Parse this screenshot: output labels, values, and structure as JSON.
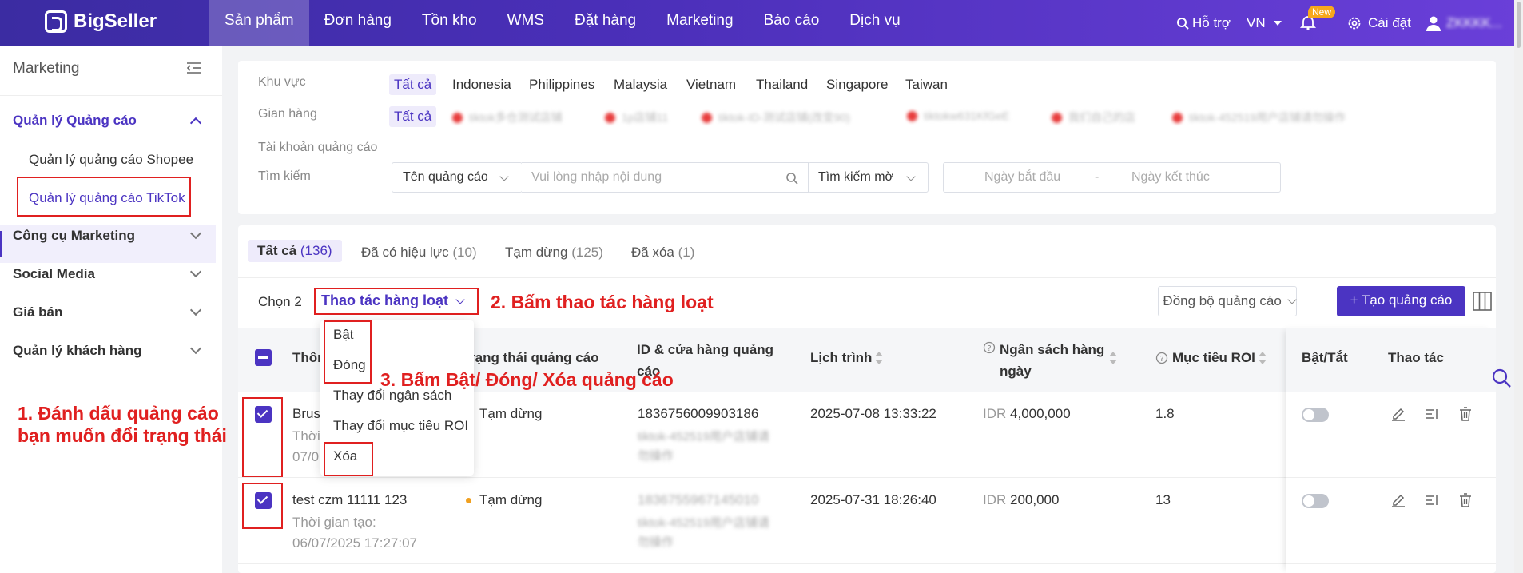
{
  "app": {
    "logo_text": "BigSeller"
  },
  "topnav": {
    "items": [
      "Sản phẩm",
      "Đơn hàng",
      "Tồn kho",
      "WMS",
      "Đặt hàng",
      "Marketing",
      "Báo cáo",
      "Dịch vụ"
    ],
    "support": "Hỗ trợ",
    "lang": "VN",
    "new_badge": "New",
    "settings": "Cài đặt",
    "user": "ZKKKK..."
  },
  "sidebar": {
    "title": "Marketing",
    "group_open": "Quản lý Quảng cáo",
    "sub_items": [
      "Quản lý quảng cáo Shopee",
      "Quản lý quảng cáo TikTok"
    ],
    "groups": [
      "Công cụ Marketing",
      "Social Media",
      "Giá bán",
      "Quản lý khách hàng"
    ]
  },
  "filters": {
    "region_label": "Khu vực",
    "regions": [
      "Tất cả",
      "Indonesia",
      "Philippines",
      "Malaysia",
      "Vietnam",
      "Thailand",
      "Singapore",
      "Taiwan"
    ],
    "store_label": "Gian hàng",
    "store_all": "Tất cả",
    "stores": [
      "tiktok多仓测试店铺",
      "1p店铺11",
      "tiktok-ID-测试店铺(改变90)",
      "tiktokw631KfGeE",
      "我们自己的店",
      "tiktok-452519用户店铺请勿操作"
    ],
    "account_label": "Tài khoản quảng cáo",
    "search_label": "Tìm kiếm",
    "search_field": "Tên quảng cáo",
    "search_placeholder": "Vui lòng nhập nội dung",
    "search_mode": "Tìm kiếm mờ",
    "date_start": "Ngày bắt đầu",
    "date_sep": "-",
    "date_end": "Ngày kết thúc"
  },
  "tabs": [
    {
      "label": "Tất cả",
      "count": "(136)"
    },
    {
      "label": "Đã có hiệu lực",
      "count": "(10)"
    },
    {
      "label": "Tạm dừng",
      "count": "(125)"
    },
    {
      "label": "Đã xóa",
      "count": "(1)"
    }
  ],
  "toolbar": {
    "selected": "Chọn 2",
    "bulk_action": "Thao tác hàng loạt",
    "sync_button": "Đồng bộ quảng cáo",
    "create_button": "+ Tạo quảng cáo"
  },
  "bulk_menu": [
    "Bật",
    "Đóng",
    "Thay đổi ngân sách",
    "Thay đổi mục tiêu ROI",
    "Xóa"
  ],
  "table": {
    "headers": {
      "info": "Thôn",
      "status": "rạng thái quảng cáo",
      "id_store": "ID & cửa hàng quảng cáo",
      "schedule": "Lịch trình",
      "budget": "Ngân sách hàng ngày",
      "roi": "Mục tiêu ROI",
      "toggle": "Bật/Tắt",
      "actions": "Thao tác"
    },
    "rows": [
      {
        "name": "Brus",
        "created_label": "Thời",
        "created": "07/0",
        "status": "Tạm dừng",
        "id": "1836756009903186",
        "store": "tiktok-452519用户店铺请勿操作",
        "schedule": "2025-07-08 13:33:22",
        "currency": "IDR",
        "budget": "4,000,000",
        "roi": "1.8"
      },
      {
        "name": "test czm 11111 123",
        "created_label": "Thời gian tạo:",
        "created": "06/07/2025 17:27:07",
        "status": "Tạm dừng",
        "id": "1836755967145010",
        "store": "tiktok-452519用户店铺请勿操作",
        "schedule": "2025-07-31 18:26:40",
        "currency": "IDR",
        "budget": "200,000",
        "roi": "13"
      }
    ]
  },
  "annotations": {
    "step1_line1": "1. Đánh dấu quảng cáo",
    "step1_line2": "bạn muốn đổi trạng thái",
    "step2": "2. Bấm thao tác hàng loạt",
    "step3": "3. Bấm Bật/ Đóng/ Xóa quảng cáo"
  },
  "colors": {
    "brand": "#4b34c2",
    "annotation": "#e02020",
    "status_paused": "#f0a020"
  }
}
